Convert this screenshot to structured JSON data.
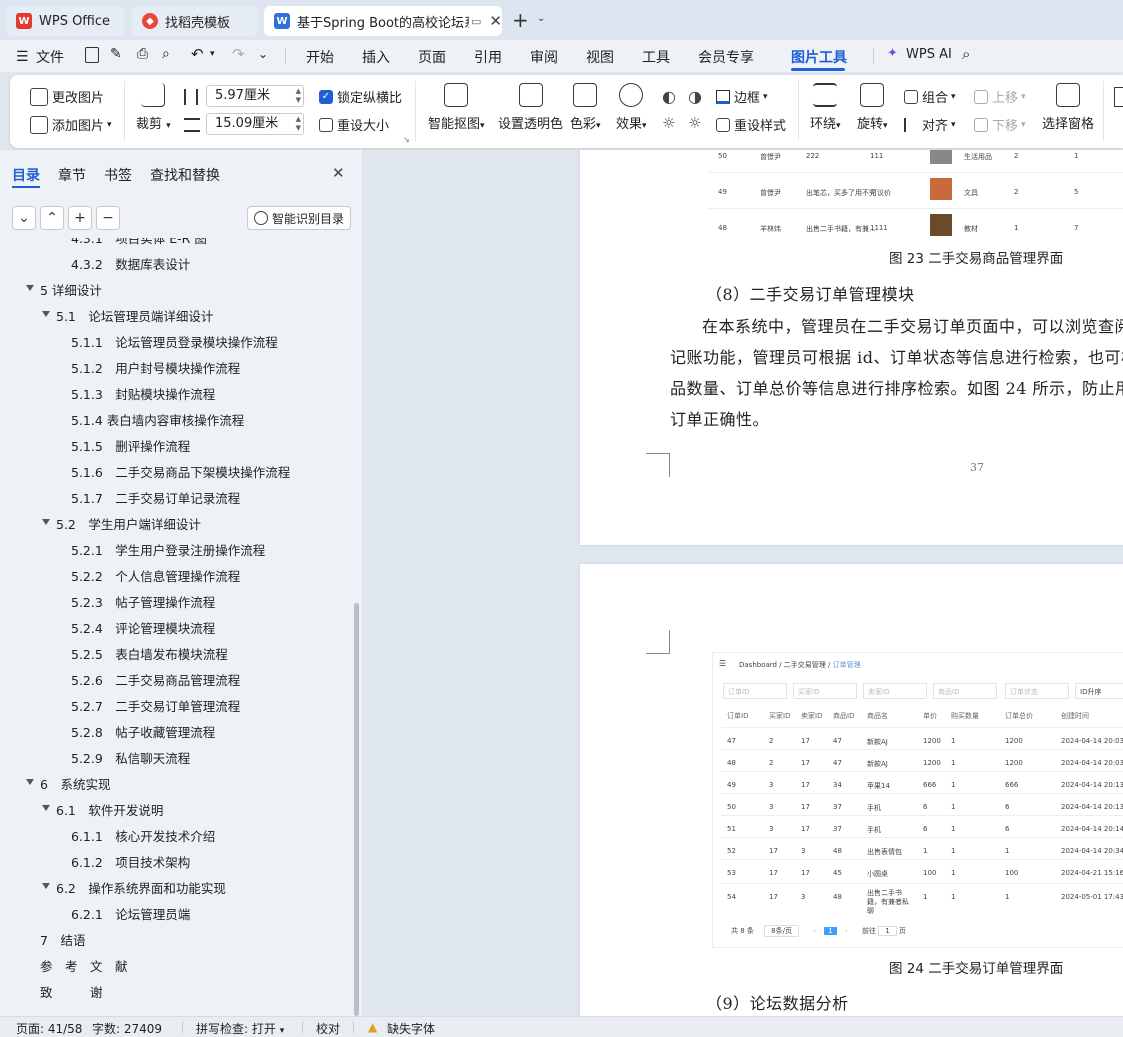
{
  "tabs": [
    {
      "label": "WPS Office",
      "icon": "wps-logo-icon"
    },
    {
      "label": "找稻壳模板",
      "icon": "docer-icon"
    },
    {
      "label": "基于Spring Boot的高校论坛系",
      "icon": "word-doc-icon"
    }
  ],
  "menu": {
    "file": "文件",
    "items": [
      "开始",
      "插入",
      "页面",
      "引用",
      "审阅",
      "视图",
      "工具",
      "会员专享",
      "图片工具"
    ],
    "active": "图片工具",
    "wps_ai": "WPS AI"
  },
  "ribbon": {
    "change_pic": "更改图片",
    "add_pic": "添加图片",
    "crop": "裁剪",
    "width": "5.97厘米",
    "height": "15.09厘米",
    "lock_ratio": "锁定纵横比",
    "reset_size": "重设大小",
    "smart_cutout": "智能抠图",
    "transparent": "设置透明色",
    "color": "色彩",
    "effect": "效果",
    "border": "边框",
    "reset_style": "重设样式",
    "wrap": "环绕",
    "rotate": "旋转",
    "group": "组合",
    "align": "对齐",
    "move_up": "上移",
    "move_down": "下移",
    "selection_pane": "选择窗格"
  },
  "sidebar": {
    "tabs": [
      "目录",
      "章节",
      "书签",
      "查找和替换"
    ],
    "active_tab": "目录",
    "smart_toc": "智能识别目录",
    "toc": [
      {
        "text": "4.3.1　项目实体 E-R 图",
        "level": 3
      },
      {
        "text": "4.3.2　数据库表设计",
        "level": 3
      },
      {
        "text": "5 详细设计",
        "level": 1,
        "expanded": true
      },
      {
        "text": "5.1　论坛管理员端详细设计",
        "level": 2,
        "expanded": true
      },
      {
        "text": "5.1.1　论坛管理员登录模块操作流程",
        "level": 3
      },
      {
        "text": "5.1.2　用户封号模块操作流程",
        "level": 3
      },
      {
        "text": "5.1.3　封贴模块操作流程",
        "level": 3
      },
      {
        "text": "5.1.4  表白墙内容审核操作流程",
        "level": 3
      },
      {
        "text": "5.1.5　删评操作流程",
        "level": 3
      },
      {
        "text": "5.1.6　二手交易商品下架模块操作流程",
        "level": 3
      },
      {
        "text": "5.1.7　二手交易订单记录流程",
        "level": 3
      },
      {
        "text": "5.2　学生用户端详细设计",
        "level": 2,
        "expanded": true
      },
      {
        "text": "5.2.1　学生用户登录注册操作流程",
        "level": 3
      },
      {
        "text": "5.2.2　个人信息管理操作流程",
        "level": 3
      },
      {
        "text": "5.2.3　帖子管理操作流程",
        "level": 3
      },
      {
        "text": "5.2.4　评论管理模块流程",
        "level": 3
      },
      {
        "text": "5.2.5　表白墙发布模块流程",
        "level": 3
      },
      {
        "text": "5.2.6　二手交易商品管理流程",
        "level": 3
      },
      {
        "text": "5.2.7　二手交易订单管理流程",
        "level": 3
      },
      {
        "text": "5.2.8　帖子收藏管理流程",
        "level": 3
      },
      {
        "text": "5.2.9　私信聊天流程",
        "level": 3
      },
      {
        "text": "6　系统实现",
        "level": 1,
        "expanded": true
      },
      {
        "text": "6.1　软件开发说明",
        "level": 2,
        "expanded": true
      },
      {
        "text": "6.1.1　核心开发技术介绍",
        "level": 3
      },
      {
        "text": "6.1.2　项目技术架构",
        "level": 3
      },
      {
        "text": "6.2　操作系统界面和功能实现",
        "level": 2,
        "expanded": true
      },
      {
        "text": "6.2.1　论坛管理员端",
        "level": 3
      },
      {
        "text": "7　结语",
        "level": 1
      },
      {
        "text": "参　考　文　献",
        "level": 1
      },
      {
        "text": "致　　　谢",
        "level": 1
      }
    ]
  },
  "document": {
    "page37": {
      "top_table_rows": [
        {
          "id": "50",
          "seller": "曾憬尹",
          "desc": "222",
          "note": "111",
          "cat": "生活用品",
          "qty": "2",
          "n": "1"
        },
        {
          "id": "49",
          "seller": "曾憬尹",
          "desc": "出笔芯，买多了用不完",
          "note": "可议价",
          "cat": "文具",
          "qty": "2",
          "n": "5"
        },
        {
          "id": "48",
          "seller": "羊林炜",
          "desc": "出售二手书籍，有兼...",
          "note": "1111",
          "cat": "教材",
          "qty": "1",
          "n": "7"
        }
      ],
      "caption": "图 23 二手交易商品管理界面",
      "heading": "（8）二手交易订单管理模块",
      "lines": [
        "在本系统中，管理员在二手交易订单页面中，可以浏览查阅交",
        "记账功能，管理员可根据 id、订单状态等信息进行检索，也可根据",
        "品数量、订单总价等信息进行排序检索。如图 24 所示，防止用户",
        "订单正确性。"
      ],
      "page_number": "37"
    },
    "page38": {
      "breadcrumb": [
        "Dashboard",
        "二手交易管理",
        "订单管理"
      ],
      "filters": [
        "订单ID",
        "买家ID",
        "卖家ID",
        "商品ID",
        "订单状态",
        "ID升序"
      ],
      "headers": [
        "订单ID",
        "买家ID",
        "卖家ID",
        "商品ID",
        "商品名",
        "单价",
        "购买数量",
        "订单总价",
        "创建时间"
      ],
      "rows": [
        [
          "47",
          "2",
          "17",
          "47",
          "新款AJ",
          "1200",
          "1",
          "1200",
          "2024-04-14 20:03:24"
        ],
        [
          "48",
          "2",
          "17",
          "47",
          "新款AJ",
          "1200",
          "1",
          "1200",
          "2024-04-14 20:03:34"
        ],
        [
          "49",
          "3",
          "17",
          "34",
          "苹果14",
          "666",
          "1",
          "666",
          "2024-04-14 20:13:53"
        ],
        [
          "50",
          "3",
          "17",
          "37",
          "手机",
          "6",
          "1",
          "6",
          "2024-04-14 20:13:56"
        ],
        [
          "51",
          "3",
          "17",
          "37",
          "手机",
          "6",
          "1",
          "6",
          "2024-04-14 20:14:03"
        ],
        [
          "52",
          "17",
          "3",
          "48",
          "出售表情包",
          "1",
          "1",
          "1",
          "2024-04-14 20:34:41"
        ],
        [
          "53",
          "17",
          "17",
          "45",
          "小圆桌",
          "100",
          "1",
          "100",
          "2024-04-21 15:16:03"
        ],
        [
          "54",
          "17",
          "3",
          "48",
          "出售二手书籍，有兼者私聊",
          "1",
          "1",
          "1",
          "2024-05-01 17:43:48"
        ]
      ],
      "pager": {
        "total": "共 8 条",
        "per_page": "8条/页",
        "current": "1",
        "goto": "前往",
        "goto_val": "1",
        "unit": "页"
      },
      "caption": "图 24 二手交易订单管理界面",
      "heading": "（9）论坛数据分析"
    }
  },
  "status": {
    "page": "页面: 41/58",
    "words": "字数: 27409",
    "spell": "拼写检查: 打开",
    "proof": "校对",
    "missing_font": "缺失字体"
  },
  "colors": {
    "accent": "#1e5fd6",
    "wps_red": "#e23a2e",
    "docer_red": "#e8483a",
    "word_blue": "#2f6fe0"
  }
}
